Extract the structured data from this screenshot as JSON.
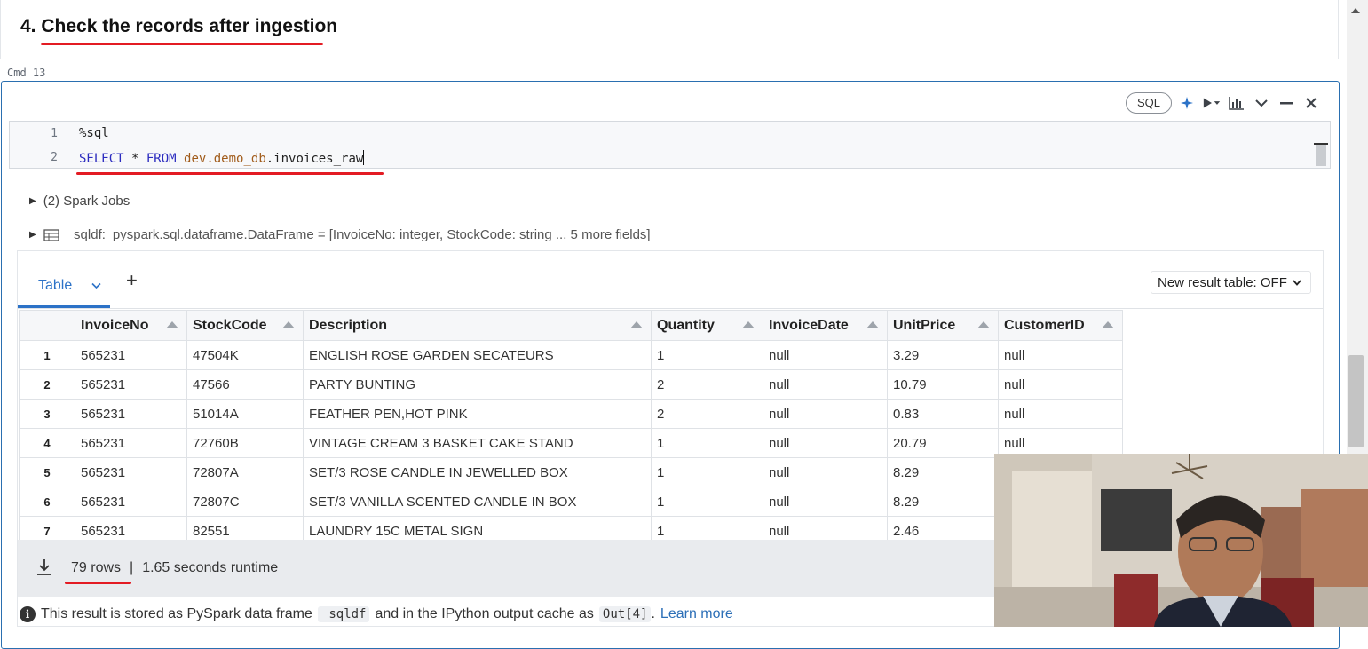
{
  "markdown": {
    "title": "4. Check the records after ingestion"
  },
  "cell": {
    "cmd_label": "Cmd 13",
    "language": "SQL",
    "code": {
      "line_numbers": [
        "1",
        "2"
      ],
      "line1": "%sql",
      "line2_keyword1": "SELECT",
      "line2_star": " * ",
      "line2_keyword2": "FROM",
      "line2_space": " ",
      "line2_db": "dev.demo_db",
      "line2_table": ".invoices_raw"
    },
    "spark_jobs": "(2) Spark Jobs",
    "dataframe_name": "_sqldf:",
    "dataframe_schema": "pyspark.sql.dataframe.DataFrame = [InvoiceNo: integer, StockCode: string ... 5 more fields]"
  },
  "results": {
    "tab_label": "Table",
    "add_label": "+",
    "new_result_table": "New result table: OFF",
    "columns": [
      "InvoiceNo",
      "StockCode",
      "Description",
      "Quantity",
      "InvoiceDate",
      "UnitPrice",
      "CustomerID"
    ],
    "rows": [
      [
        "1",
        "565231",
        "47504K",
        "ENGLISH ROSE GARDEN SECATEURS",
        "1",
        "null",
        "3.29",
        "null"
      ],
      [
        "2",
        "565231",
        "47566",
        "PARTY BUNTING",
        "2",
        "null",
        "10.79",
        "null"
      ],
      [
        "3",
        "565231",
        "51014A",
        "FEATHER PEN,HOT PINK",
        "2",
        "null",
        "0.83",
        "null"
      ],
      [
        "4",
        "565231",
        "72760B",
        "VINTAGE CREAM 3 BASKET CAKE STAND",
        "1",
        "null",
        "20.79",
        "null"
      ],
      [
        "5",
        "565231",
        "72807A",
        "SET/3 ROSE CANDLE IN JEWELLED BOX",
        "1",
        "null",
        "8.29",
        "null"
      ],
      [
        "6",
        "565231",
        "72807C",
        "SET/3 VANILLA SCENTED CANDLE IN BOX",
        "1",
        "null",
        "8.29",
        "null"
      ],
      [
        "7",
        "565231",
        "82551",
        "LAUNDRY 15C METAL SIGN",
        "1",
        "null",
        "2.46",
        "null"
      ]
    ],
    "row_count": "79 rows",
    "separator": "|",
    "runtime": "1.65 seconds runtime",
    "info": {
      "part1": "This result is stored as PySpark data frame",
      "chip1": "_sqldf",
      "part2": "and in the IPython output cache as",
      "chip2": "Out[4]",
      "part3": ".",
      "learn_more": "Learn more"
    }
  },
  "colors": {
    "accent": "#2c72c7",
    "annotation_red": "#e31b23",
    "cell_border": "#2a6fb0"
  }
}
